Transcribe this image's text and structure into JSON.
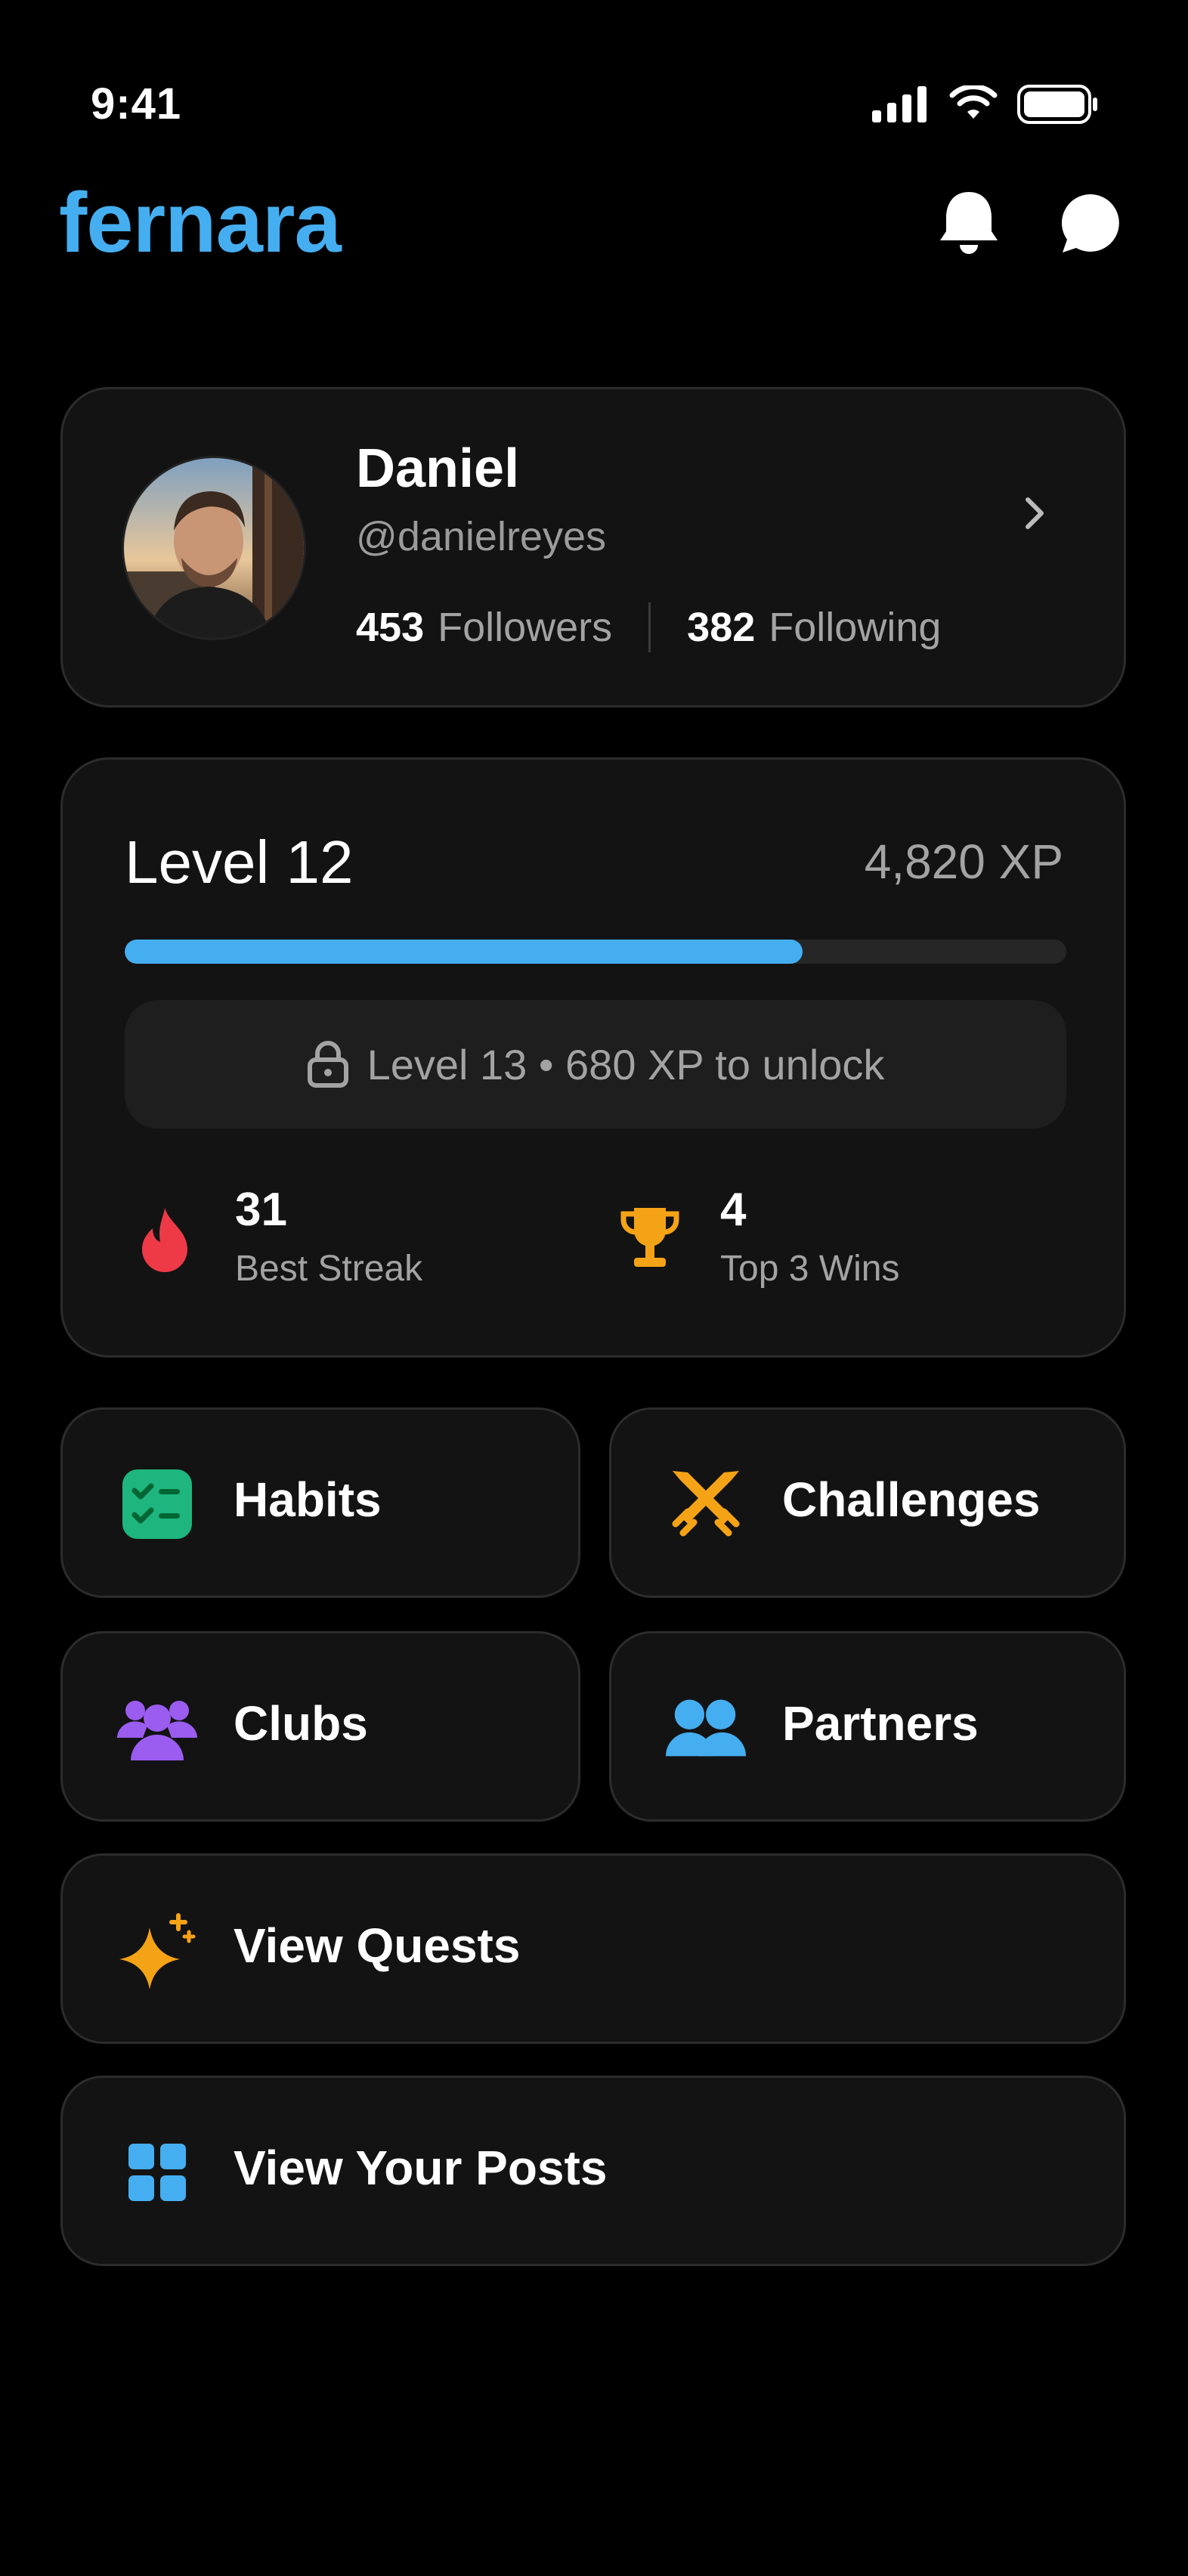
{
  "status_bar": {
    "time": "9:41"
  },
  "header": {
    "brand": "fernara",
    "notification_icon": "bell-icon",
    "messages_icon": "chat-bubble-icon"
  },
  "profile": {
    "name": "Daniel",
    "handle": "@danielreyes",
    "followers_count": "453",
    "followers_label": "Followers",
    "following_count": "382",
    "following_label": "Following"
  },
  "level": {
    "title": "Level 12",
    "xp": "4,820 XP",
    "progress_fraction": 0.72,
    "unlock_text": "Level 13 • 680 XP to unlock",
    "best_streak_value": "31",
    "best_streak_label": "Best Streak",
    "top_wins_value": "4",
    "top_wins_label": "Top 3 Wins"
  },
  "menu": {
    "habits": "Habits",
    "challenges": "Challenges",
    "clubs": "Clubs",
    "partners": "Partners",
    "quests": "View Quests",
    "posts": "View Your Posts"
  },
  "colors": {
    "accent": "#45aef0",
    "habits": "#1fb57f",
    "challenges": "#f5a316",
    "clubs": "#9b5cf0",
    "partners": "#45aef0",
    "quests": "#f5a316",
    "streak": "#ee3a47",
    "trophy": "#f5a316"
  }
}
